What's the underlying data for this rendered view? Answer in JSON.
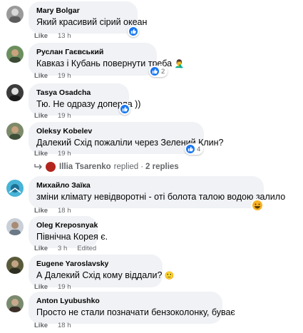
{
  "comments": [
    {
      "author": "Mary Bolgar",
      "text": "Який красивий сірий океан",
      "like": "Like",
      "time": "13 h",
      "reactions": ""
    },
    {
      "author": "Руслан Гаєвський",
      "text": "Кавказ і Кубань повернути треба",
      "like": "Like",
      "time": "19 h",
      "reactions": "2"
    },
    {
      "author": "Tasya Osadcha",
      "text": "Тю. Не одразу доперла ))",
      "like": "Like",
      "time": "19 h",
      "reactions": ""
    },
    {
      "author": "Oleksy Kobelev",
      "text": "Далекий Схід пожаліли через Зелений Клин?",
      "like": "Like",
      "time": "19 h",
      "reactions": "4"
    },
    {
      "author": "Михайло Заїка",
      "text": "зміни клімату невідворотні - оті болота талою водою залило",
      "like": "Like",
      "time": "18 h",
      "reactions": ""
    },
    {
      "author": "Oleg Kreposnyak",
      "text": "Північна Корея є.",
      "like": "Like",
      "time": "3 h",
      "edited": "Edited",
      "reactions": ""
    },
    {
      "author": "Eugene Yaroslavsky",
      "text": "А Далекий Схід кому віддали?",
      "like": "Like",
      "time": "19 h",
      "reactions": ""
    },
    {
      "author": "Anton Lyubushko",
      "text": "Просто не стали позначати бензоколонку, буває",
      "like": "Like",
      "time": "18 h",
      "reactions": ""
    }
  ],
  "replies_row": {
    "name": "Illia Tsarenko",
    "action": "replied",
    "separator": "·",
    "count": "2 replies"
  },
  "icons": {
    "like": "thumbs-up-icon",
    "laugh": "laugh-emoji-icon",
    "reply_arrow": "reply-arrow-icon"
  },
  "colors": {
    "bubble": "#f0f2f5",
    "meta": "#65676b",
    "like_blue": "#1877f2"
  }
}
